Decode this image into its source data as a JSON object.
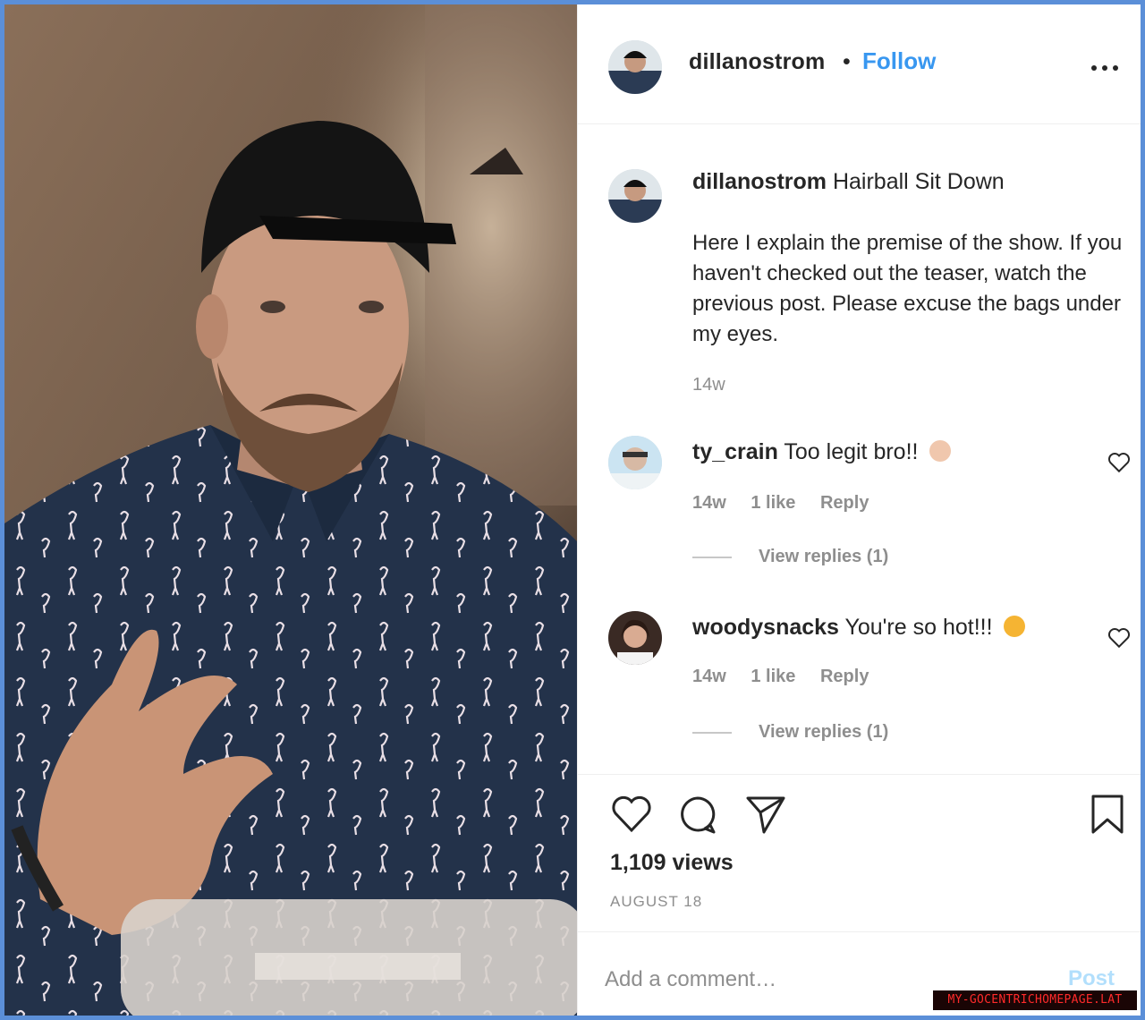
{
  "post": {
    "username": "dillanostrom",
    "follow_label": "Follow",
    "separator": "•",
    "caption_title": "Hairball Sit Down",
    "caption_body": "Here I explain the premise of the show. If you haven't checked out the teaser, watch the previous post. Please excuse the bags under my eyes.",
    "caption_time": "14w",
    "views": "1,109 views",
    "date": "AUGUST 18"
  },
  "comments": [
    {
      "username": "ty_crain",
      "text": "Too legit bro!!",
      "emoji_icon": "ok-hand-emoji-icon",
      "time": "14w",
      "likes": "1 like",
      "reply_label": "Reply",
      "view_replies": "View replies (1)"
    },
    {
      "username": "woodysnacks",
      "text": "You're so hot!!!",
      "emoji_icon": "heart-eyes-emoji-icon",
      "time": "14w",
      "likes": "1 like",
      "reply_label": "Reply",
      "view_replies": "View replies (1)"
    }
  ],
  "comment_box": {
    "placeholder": "Add a comment…",
    "post_label": "Post"
  },
  "icons": {
    "like": "heart-icon",
    "comment": "comment-bubble-icon",
    "share": "paper-plane-icon",
    "save": "bookmark-icon",
    "more": "more-options-icon"
  },
  "colors": {
    "accent": "#3897f0",
    "post_disabled": "#b2dffc",
    "muted": "#8e8e8e",
    "text": "#262626",
    "frame_border": "#5b8fd8"
  },
  "watermark": "MY-GOCENTRICHOMEPAGE.LAT"
}
